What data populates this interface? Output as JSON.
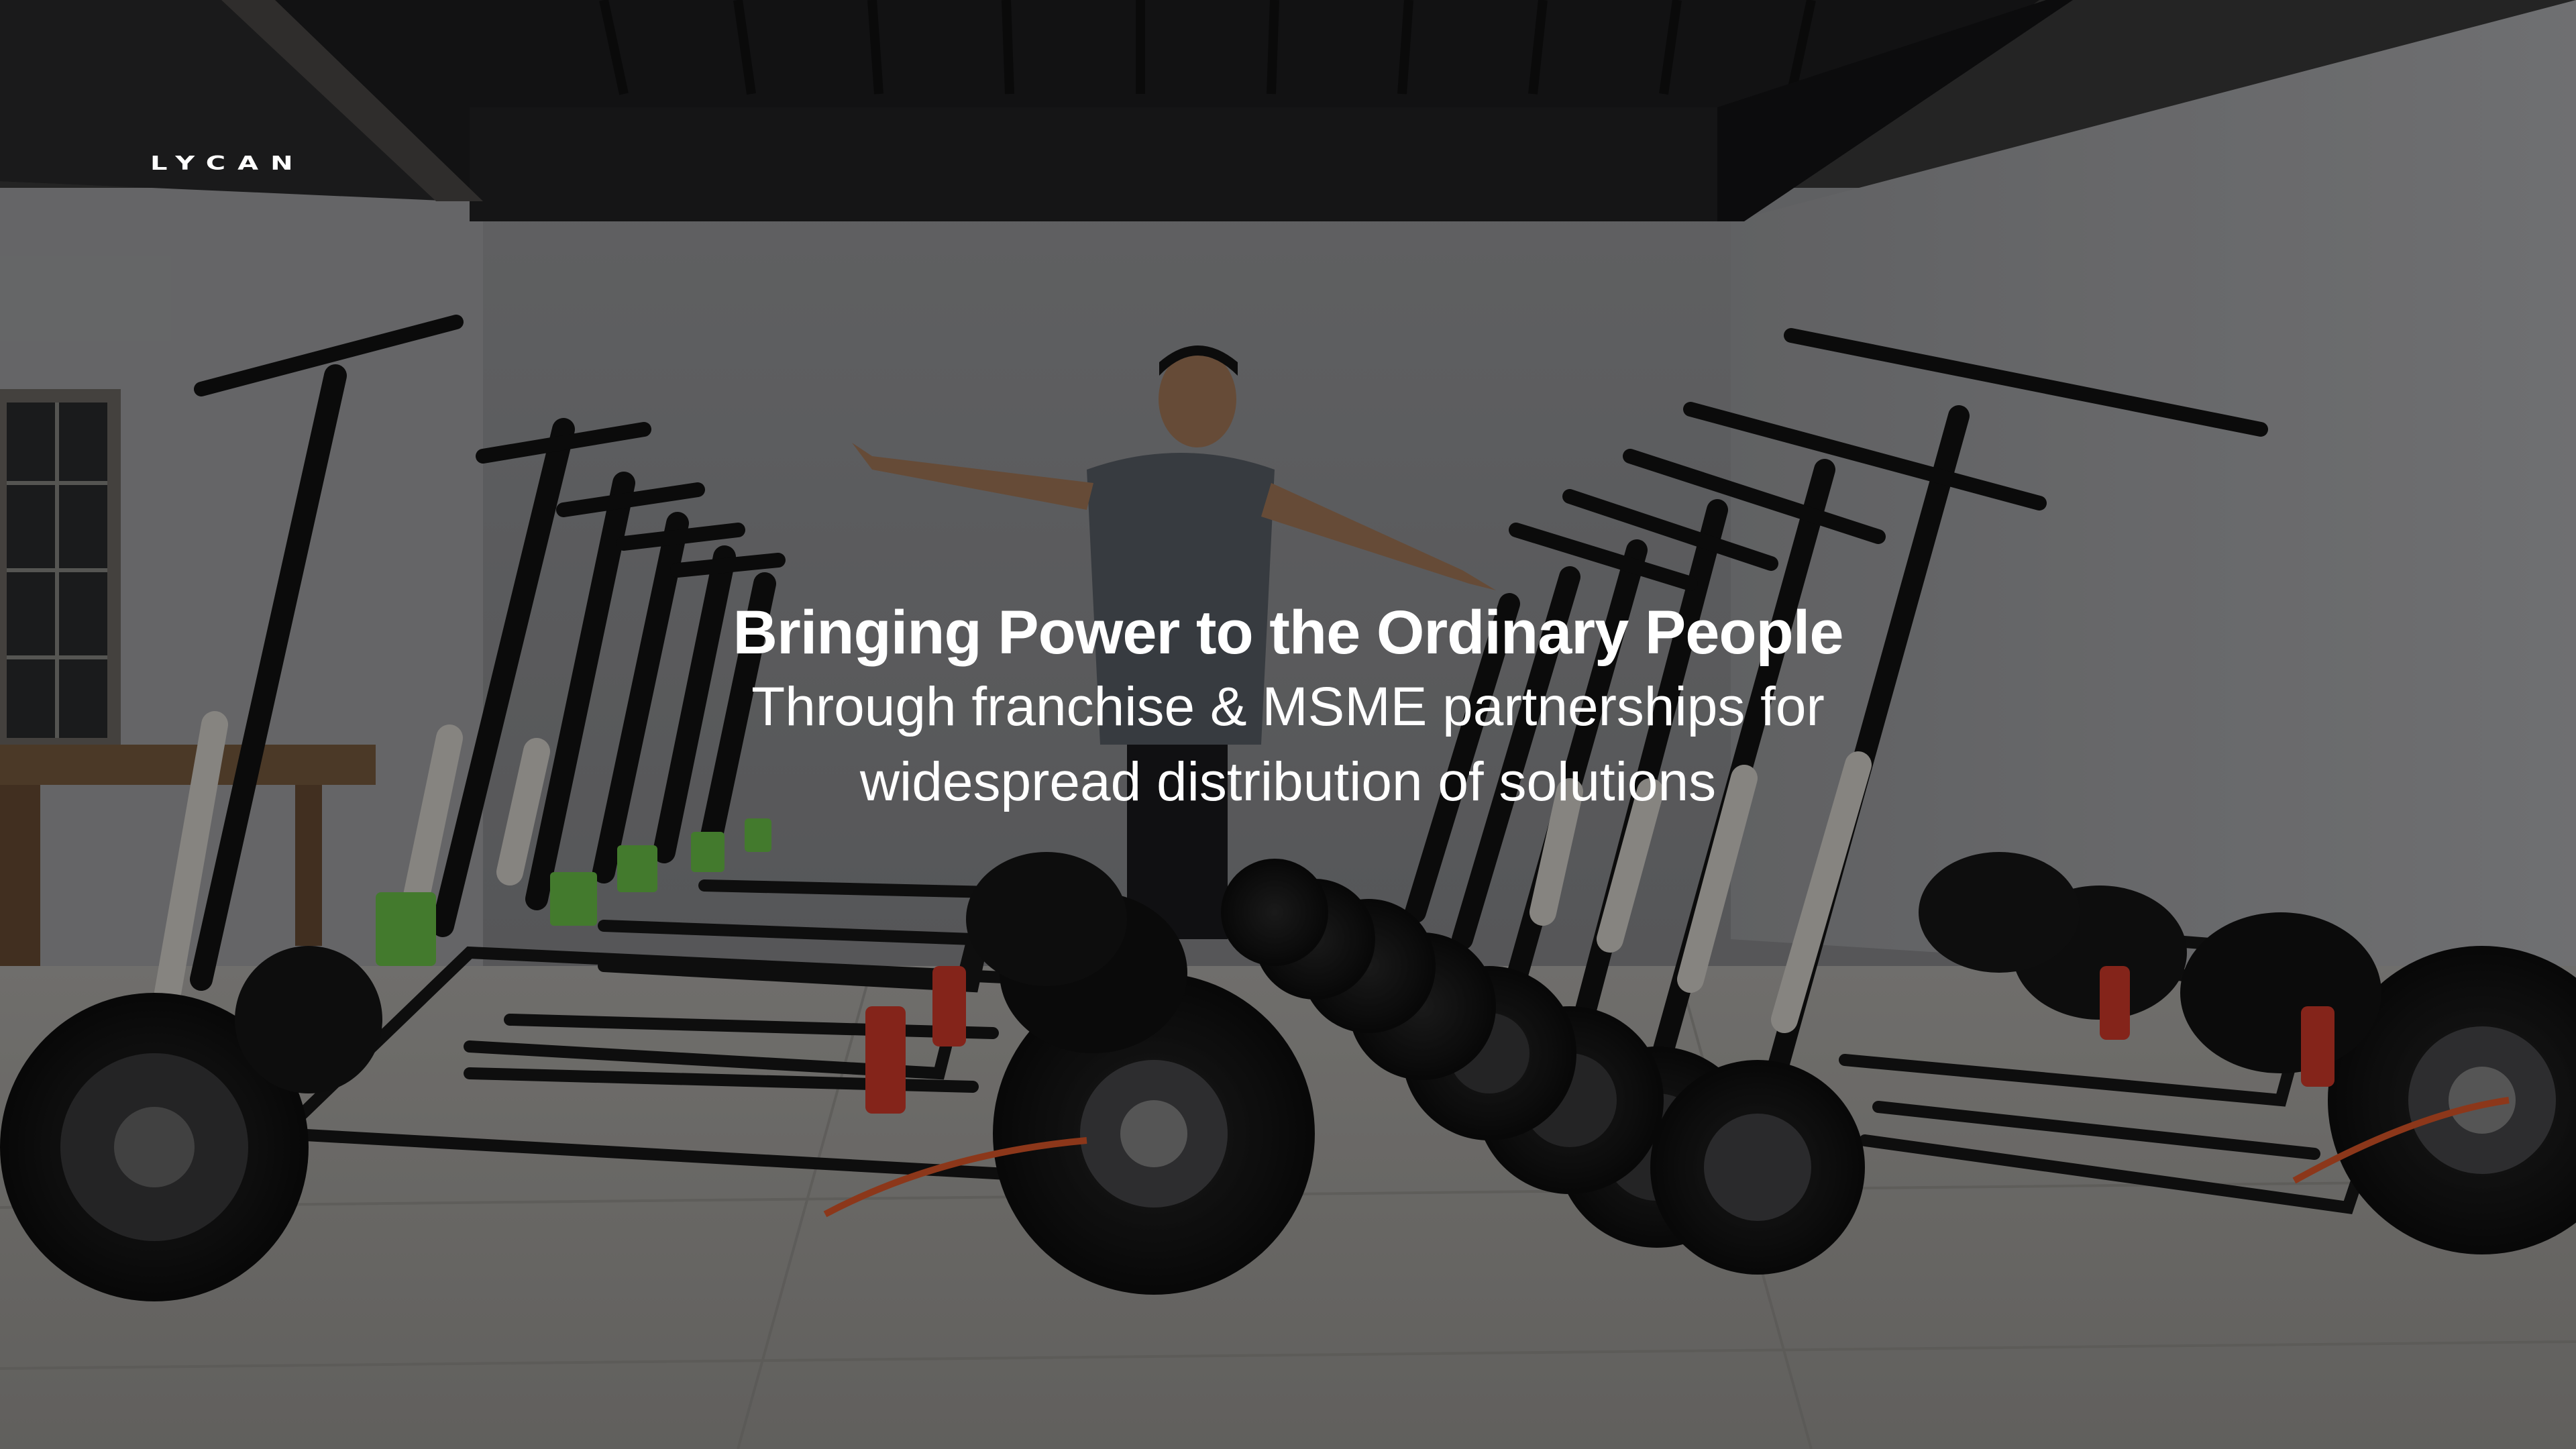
{
  "brand": {
    "logo_text": "LYCAN"
  },
  "hero": {
    "headline": "Bringing Power to the Ordinary People",
    "subline": "Through franchise & MSME partnerships for widespread distribution of solutions"
  },
  "colors": {
    "text": "#ffffff",
    "overlay": "rgba(0,0,0,0.38)",
    "wall": "#8e8f92",
    "ceiling": "#1c1c1e",
    "floor": "#a5a39f",
    "accent_green": "#6cc64a",
    "accent_red": "#d63a2a",
    "accent_orange": "#e25a2a"
  }
}
